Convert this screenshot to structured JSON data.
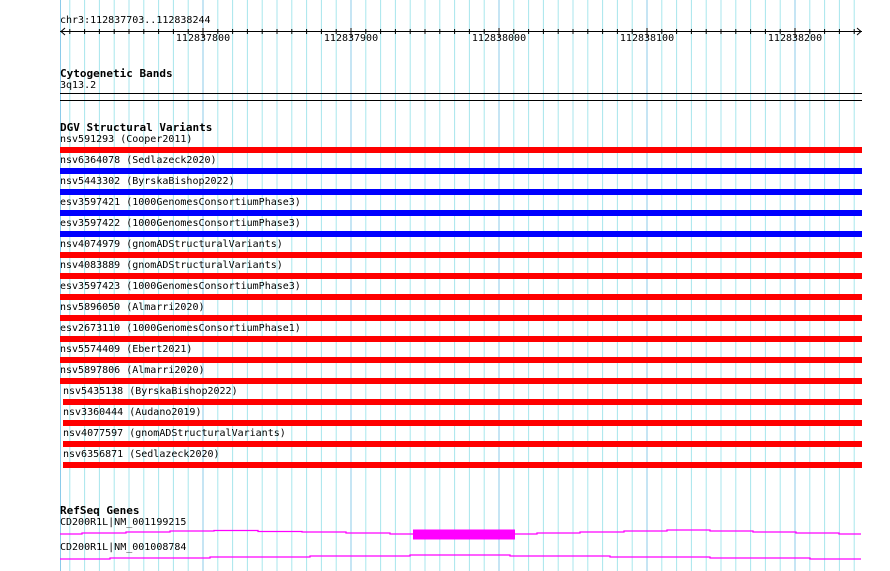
{
  "location": "chr3:112837703..112838244",
  "ruler": {
    "ticks": [
      "112837800",
      "112837900",
      "112838000",
      "112838100",
      "112838200"
    ]
  },
  "cytoband_track": {
    "title": "Cytogenetic Bands",
    "band": "3q13.2"
  },
  "dgv_track": {
    "title": "DGV Structural Variants",
    "colors": {
      "loss": "#ff0000",
      "gain": "#0000ff"
    },
    "variants": [
      {
        "label": "nsv591293 (Cooper2011)",
        "color": "#ff0000"
      },
      {
        "label": "nsv6364078 (Sedlazeck2020)",
        "color": "#0000ff"
      },
      {
        "label": "nsv5443302 (ByrskaBishop2022)",
        "color": "#0000ff"
      },
      {
        "label": "esv3597421 (1000GenomesConsortiumPhase3)",
        "color": "#0000ff"
      },
      {
        "label": "esv3597422 (1000GenomesConsortiumPhase3)",
        "color": "#0000ff"
      },
      {
        "label": "nsv4074979 (gnomADStructuralVariants)",
        "color": "#ff0000"
      },
      {
        "label": "nsv4083889 (gnomADStructuralVariants)",
        "color": "#ff0000"
      },
      {
        "label": "esv3597423 (1000GenomesConsortiumPhase3)",
        "color": "#ff0000"
      },
      {
        "label": "nsv5896050 (Almarri2020)",
        "color": "#ff0000"
      },
      {
        "label": "esv2673110 (1000GenomesConsortiumPhase1)",
        "color": "#ff0000"
      },
      {
        "label": "nsv5574409 (Ebert2021)",
        "color": "#ff0000"
      },
      {
        "label": "nsv5897806 (Almarri2020)",
        "color": "#ff0000"
      },
      {
        "label": "nsv5435138 (ByrskaBishop2022)",
        "color": "#ff0000"
      },
      {
        "label": "nsv3360444 (Audano2019)",
        "color": "#ff0000"
      },
      {
        "label": "nsv4077597 (gnomADStructuralVariants)",
        "color": "#ff0000"
      },
      {
        "label": "nsv6356871 (Sedlazeck2020)",
        "color": "#ff0000"
      }
    ]
  },
  "refseq_track": {
    "title": "RefSeq Genes",
    "color": "#ff00ff",
    "transcripts": [
      {
        "label": "CD200R1L|NM_001199215"
      },
      {
        "label": "CD200R1L|NM_001008784"
      }
    ]
  }
}
